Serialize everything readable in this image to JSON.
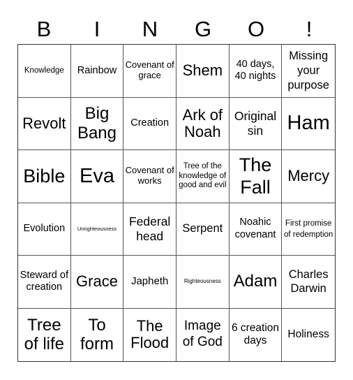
{
  "header": {
    "letters": [
      "B",
      "I",
      "N",
      "G",
      "O",
      "!"
    ]
  },
  "board": {
    "rows": [
      [
        "Knowledge",
        "Rainbow",
        "Covenant of grace",
        "Shem",
        "40 days, 40 nights",
        "Missing your purpose"
      ],
      [
        "Revolt",
        "Big Bang",
        "Creation",
        "Ark of Noah",
        "Original sin",
        "Ham"
      ],
      [
        "Bible",
        "Eva",
        "Covenant of works",
        "Tree of the knowledge of good and evil",
        "The Fall",
        "Mercy"
      ],
      [
        "Evolution",
        "Unrighteousness",
        "Federal head",
        "Serpent",
        "Noahic covenant",
        "First promise of redemption"
      ],
      [
        "Steward of creation",
        "Grace",
        "Japheth",
        "Righteousness",
        "Adam",
        "Charles Darwin"
      ],
      [
        "Tree of life",
        "To form",
        "The Flood",
        "Image of God",
        "6 creation days",
        "Holiness"
      ]
    ]
  }
}
